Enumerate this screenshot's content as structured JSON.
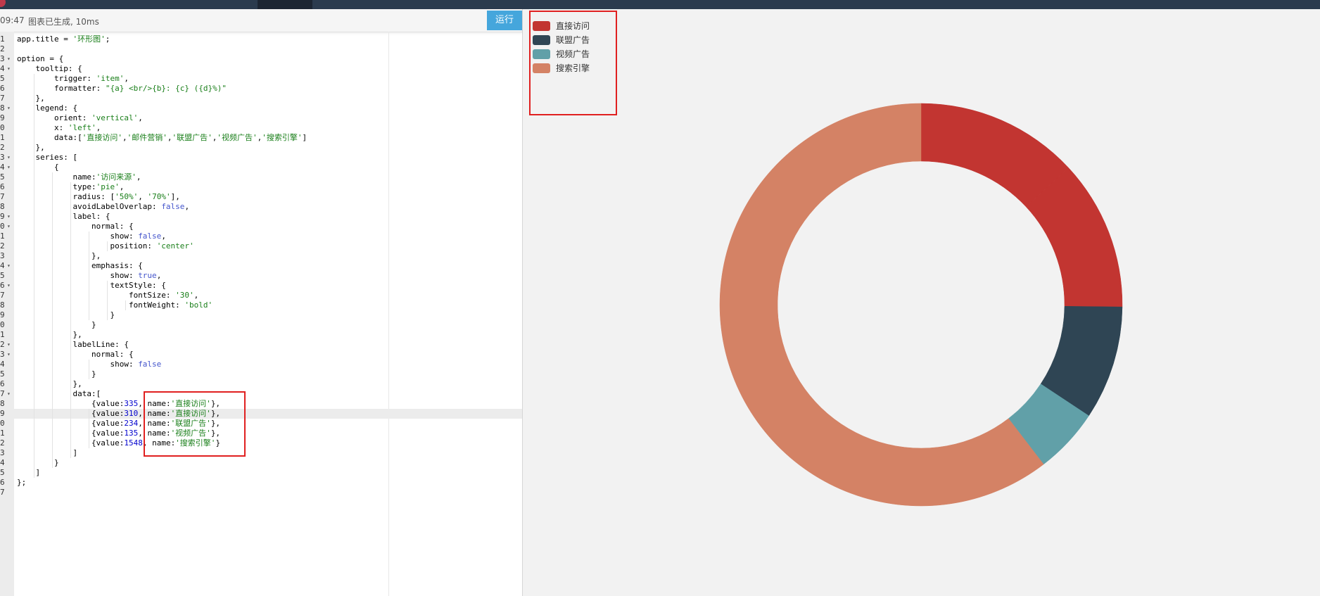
{
  "statusbar": {
    "time": "09:47",
    "message": "图表已生成, 10ms",
    "run_label": "运行"
  },
  "code_lines": [
    {
      "n": "1",
      "fold": false,
      "tokens": [
        [
          "app.title = ",
          ""
        ],
        [
          "'环形图'",
          "str"
        ],
        [
          ";",
          ""
        ]
      ]
    },
    {
      "n": "2",
      "fold": false,
      "tokens": []
    },
    {
      "n": "3",
      "fold": true,
      "tokens": [
        [
          "option = {",
          ""
        ]
      ]
    },
    {
      "n": "4",
      "fold": true,
      "tokens": [
        [
          "    tooltip: {",
          ""
        ]
      ]
    },
    {
      "n": "5",
      "fold": false,
      "tokens": [
        [
          "        trigger: ",
          ""
        ],
        [
          "'item'",
          "str"
        ],
        [
          ",",
          ""
        ]
      ]
    },
    {
      "n": "6",
      "fold": false,
      "tokens": [
        [
          "        formatter: ",
          ""
        ],
        [
          "\"{a} <br/>{b}: {c} ({d}%)\"",
          "str"
        ]
      ]
    },
    {
      "n": "7",
      "fold": false,
      "tokens": [
        [
          "    },",
          ""
        ]
      ]
    },
    {
      "n": "8",
      "fold": true,
      "tokens": [
        [
          "    legend: {",
          ""
        ]
      ]
    },
    {
      "n": "9",
      "fold": false,
      "tokens": [
        [
          "        orient: ",
          ""
        ],
        [
          "'vertical'",
          "str"
        ],
        [
          ",",
          ""
        ]
      ]
    },
    {
      "n": "0",
      "fold": false,
      "tokens": [
        [
          "        x: ",
          ""
        ],
        [
          "'left'",
          "str"
        ],
        [
          ",",
          ""
        ]
      ]
    },
    {
      "n": "1",
      "fold": false,
      "tokens": [
        [
          "        data:[",
          ""
        ],
        [
          "'直接访问'",
          "str"
        ],
        [
          ",",
          ""
        ],
        [
          "'邮件营销'",
          "str"
        ],
        [
          ",",
          ""
        ],
        [
          "'联盟广告'",
          "str"
        ],
        [
          ",",
          ""
        ],
        [
          "'视频广告'",
          "str"
        ],
        [
          ",",
          ""
        ],
        [
          "'搜索引擎'",
          "str"
        ],
        [
          "]",
          ""
        ]
      ]
    },
    {
      "n": "2",
      "fold": false,
      "tokens": [
        [
          "    },",
          ""
        ]
      ]
    },
    {
      "n": "3",
      "fold": true,
      "tokens": [
        [
          "    series: [",
          ""
        ]
      ]
    },
    {
      "n": "4",
      "fold": true,
      "tokens": [
        [
          "        {",
          ""
        ]
      ]
    },
    {
      "n": "5",
      "fold": false,
      "tokens": [
        [
          "            name:",
          ""
        ],
        [
          "'访问来源'",
          "str"
        ],
        [
          ",",
          ""
        ]
      ]
    },
    {
      "n": "6",
      "fold": false,
      "tokens": [
        [
          "            type:",
          ""
        ],
        [
          "'pie'",
          "str"
        ],
        [
          ",",
          ""
        ]
      ]
    },
    {
      "n": "7",
      "fold": false,
      "tokens": [
        [
          "            radius: [",
          ""
        ],
        [
          "'50%'",
          "str"
        ],
        [
          ", ",
          ""
        ],
        [
          "'70%'",
          "str"
        ],
        [
          "],",
          ""
        ]
      ]
    },
    {
      "n": "8",
      "fold": false,
      "tokens": [
        [
          "            avoidLabelOverlap: ",
          ""
        ],
        [
          "false",
          "kw"
        ],
        [
          ",",
          ""
        ]
      ]
    },
    {
      "n": "9",
      "fold": true,
      "tokens": [
        [
          "            label: {",
          ""
        ]
      ]
    },
    {
      "n": "0",
      "fold": true,
      "tokens": [
        [
          "                normal: {",
          ""
        ]
      ]
    },
    {
      "n": "1",
      "fold": false,
      "tokens": [
        [
          "                    show: ",
          ""
        ],
        [
          "false",
          "kw"
        ],
        [
          ",",
          ""
        ]
      ]
    },
    {
      "n": "2",
      "fold": false,
      "tokens": [
        [
          "                    position: ",
          ""
        ],
        [
          "'center'",
          "str"
        ]
      ]
    },
    {
      "n": "3",
      "fold": false,
      "tokens": [
        [
          "                },",
          ""
        ]
      ]
    },
    {
      "n": "4",
      "fold": true,
      "tokens": [
        [
          "                emphasis: {",
          ""
        ]
      ]
    },
    {
      "n": "5",
      "fold": false,
      "tokens": [
        [
          "                    show: ",
          ""
        ],
        [
          "true",
          "kw"
        ],
        [
          ",",
          ""
        ]
      ]
    },
    {
      "n": "6",
      "fold": true,
      "tokens": [
        [
          "                    textStyle: {",
          ""
        ]
      ]
    },
    {
      "n": "7",
      "fold": false,
      "tokens": [
        [
          "                        fontSize: ",
          ""
        ],
        [
          "'30'",
          "str"
        ],
        [
          ",",
          ""
        ]
      ]
    },
    {
      "n": "8",
      "fold": false,
      "tokens": [
        [
          "                        fontWeight: ",
          ""
        ],
        [
          "'bold'",
          "str"
        ]
      ]
    },
    {
      "n": "9",
      "fold": false,
      "tokens": [
        [
          "                    }",
          ""
        ]
      ]
    },
    {
      "n": "0",
      "fold": false,
      "tokens": [
        [
          "                }",
          ""
        ]
      ]
    },
    {
      "n": "1",
      "fold": false,
      "tokens": [
        [
          "            },",
          ""
        ]
      ]
    },
    {
      "n": "2",
      "fold": true,
      "tokens": [
        [
          "            labelLine: {",
          ""
        ]
      ]
    },
    {
      "n": "3",
      "fold": true,
      "tokens": [
        [
          "                normal: {",
          ""
        ]
      ]
    },
    {
      "n": "4",
      "fold": false,
      "tokens": [
        [
          "                    show: ",
          ""
        ],
        [
          "false",
          "kw"
        ]
      ]
    },
    {
      "n": "5",
      "fold": false,
      "tokens": [
        [
          "                }",
          ""
        ]
      ]
    },
    {
      "n": "6",
      "fold": false,
      "tokens": [
        [
          "            },",
          ""
        ]
      ]
    },
    {
      "n": "7",
      "fold": true,
      "tokens": [
        [
          "            data:[",
          ""
        ]
      ]
    },
    {
      "n": "8",
      "fold": false,
      "tokens": [
        [
          "                {value:",
          ""
        ],
        [
          "335",
          "num"
        ],
        [
          ", name:",
          ""
        ],
        [
          "'直接访问'",
          "str"
        ],
        [
          "},",
          ""
        ]
      ]
    },
    {
      "n": "9",
      "fold": false,
      "tokens": [
        [
          "                {value:",
          ""
        ],
        [
          "310",
          "num"
        ],
        [
          ", name:",
          ""
        ],
        [
          "'直接访问'",
          "str"
        ],
        [
          "},",
          ""
        ]
      ]
    },
    {
      "n": "0",
      "fold": false,
      "tokens": [
        [
          "                {value:",
          ""
        ],
        [
          "234",
          "num"
        ],
        [
          ", name:",
          ""
        ],
        [
          "'联盟广告'",
          "str"
        ],
        [
          "},",
          ""
        ]
      ]
    },
    {
      "n": "1",
      "fold": false,
      "tokens": [
        [
          "                {value:",
          ""
        ],
        [
          "135",
          "num"
        ],
        [
          ", name:",
          ""
        ],
        [
          "'视频广告'",
          "str"
        ],
        [
          "},",
          ""
        ]
      ]
    },
    {
      "n": "2",
      "fold": false,
      "tokens": [
        [
          "                {value:",
          ""
        ],
        [
          "1548",
          "num"
        ],
        [
          ", name:",
          ""
        ],
        [
          "'搜索引擎'",
          "str"
        ],
        [
          "}",
          ""
        ]
      ]
    },
    {
      "n": "3",
      "fold": false,
      "tokens": [
        [
          "            ]",
          ""
        ]
      ]
    },
    {
      "n": "4",
      "fold": false,
      "tokens": [
        [
          "        }",
          ""
        ]
      ]
    },
    {
      "n": "5",
      "fold": false,
      "tokens": [
        [
          "    ]",
          ""
        ]
      ]
    },
    {
      "n": "6",
      "fold": false,
      "tokens": [
        [
          "};",
          ""
        ]
      ]
    },
    {
      "n": "7",
      "fold": false,
      "tokens": []
    }
  ],
  "active_line_index": 38,
  "chart_data": {
    "type": "pie",
    "style": "donut",
    "series_name": "访问来源",
    "radius": [
      "50%",
      "70%"
    ],
    "slices": [
      {
        "name": "直接访问",
        "value": 335,
        "color": "#c23531"
      },
      {
        "name": "直接访问",
        "value": 310,
        "color": "#c23531"
      },
      {
        "name": "联盟广告",
        "value": 234,
        "color": "#2f4554"
      },
      {
        "name": "视频广告",
        "value": 135,
        "color": "#61a0a8"
      },
      {
        "name": "搜索引擎",
        "value": 1548,
        "color": "#d48265"
      }
    ],
    "legend": {
      "orient": "vertical",
      "placement": "top-left",
      "items": [
        {
          "label": "直接访问",
          "color": "#c23531"
        },
        {
          "label": "联盟广告",
          "color": "#2f4554"
        },
        {
          "label": "视频广告",
          "color": "#61a0a8"
        },
        {
          "label": "搜索引擎",
          "color": "#d48265"
        }
      ]
    }
  }
}
